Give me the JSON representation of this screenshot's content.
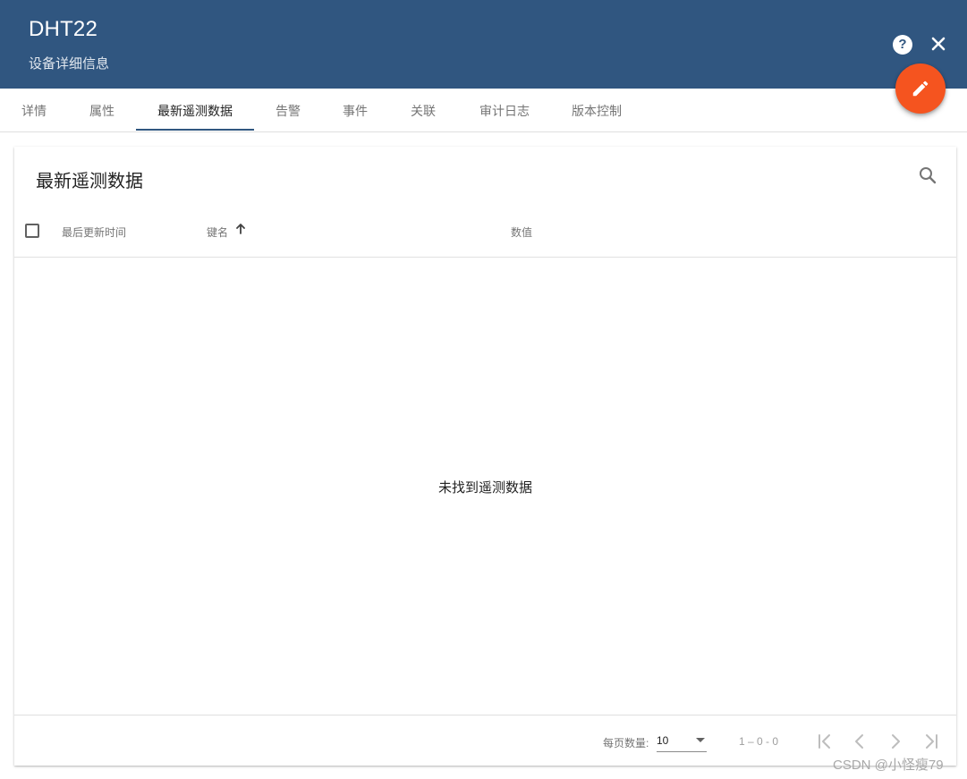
{
  "header": {
    "title": "DHT22",
    "subtitle": "设备详细信息",
    "help_icon": "help-icon",
    "close_icon": "close-icon",
    "edit_icon": "pencil-icon",
    "bg_color": "#305680",
    "fab_color": "#f5541f"
  },
  "tabs": [
    {
      "label": "详情"
    },
    {
      "label": "属性"
    },
    {
      "label": "最新遥测数据",
      "active": true
    },
    {
      "label": "告警"
    },
    {
      "label": "事件"
    },
    {
      "label": "关联"
    },
    {
      "label": "审计日志"
    },
    {
      "label": "版本控制"
    }
  ],
  "card": {
    "title": "最新遥测数据",
    "search_icon": "search-icon"
  },
  "table": {
    "columns": [
      {
        "label": "最后更新时间"
      },
      {
        "label": "键名",
        "sort": "asc"
      },
      {
        "label": "数值"
      }
    ],
    "empty_message": "未找到遥测数据"
  },
  "pagination": {
    "per_page_label": "每页数量:",
    "per_page_value": "10",
    "range": "1 – 0 - 0"
  },
  "watermark": "CSDN @小怪瘦79"
}
